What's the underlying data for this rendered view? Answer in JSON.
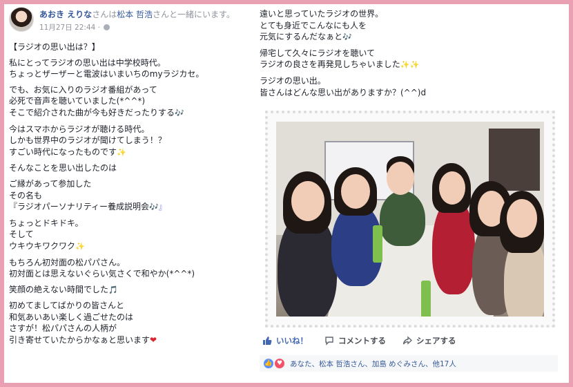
{
  "header": {
    "author": "あおき えりな",
    "with_prefix": "さんは",
    "tagged": "松本 哲浩",
    "with_suffix": "さんと一緒にいます。",
    "timestamp": "11月27日 22:44 ·"
  },
  "post_left": [
    "【ラジオの思い出は？】",
    "私にとってラジオの思い出は中学校時代。\nちょっとザーザーと電波はいまいちのmyラジカセ。",
    "でも、お気に入りのラジオ番組があって\n必死で音声を聴いていました(*^^*)\nそこで紹介された曲が今も好きだったりする",
    "今はスマホからラジオが聴ける時代。\nしかも世界中のラジオが聞けてしまう！？\nすごい時代になったものです",
    "そんなことを思い出したのは",
    "ご縁があって参加した\nその名も\n『ラジオパーソナリティー養成説明会",
    "ちょっとドキドキ。\nそして\nウキウキワクワク",
    "もちろん初対面の松パパさん。\n初対面とは思えないぐらい気さくで和やか(*^^*)",
    "笑顔の絶えない時間でした",
    "初めてましてばかりの皆さんと\n和気あいあい楽しく過ごせたのは\nさすが！松パパさんの人柄が\n引き寄せていたからかなぁと思います"
  ],
  "post_left_tails": {
    "p2": "🎶",
    "p3": "✨",
    "p5": "🎶』",
    "p6": "✨",
    "p8": "🎵",
    "p9": "❤"
  },
  "post_right": [
    "遠いと思っていたラジオの世界。\nとても身近でこんなにも人を\n元気にするんだなぁと",
    "帰宅して久々にラジオを聴いて\nラジオの良さを再発見しちゃいました",
    "ラジオの思い出。\n皆さんはどんな思い出がありますか？(^^)d"
  ],
  "post_right_tails": {
    "p0": "🎶",
    "p1": "✨✨"
  },
  "actions": {
    "like": "いいね！",
    "comment": "コメントする",
    "share": "シェアする"
  },
  "reactions": {
    "text": "あなた、松本 哲浩さん、加島 めぐみさん、他17人"
  },
  "colors": {
    "frame": "#e8a0b2",
    "link": "#365899",
    "like": "#4267b2",
    "heart": "#d8262e"
  }
}
